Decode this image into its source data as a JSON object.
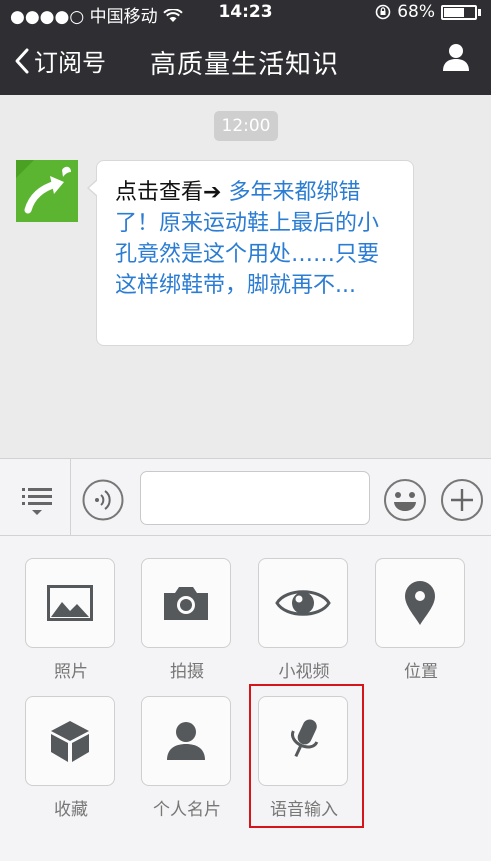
{
  "status_bar": {
    "signal": "●●●●○ 中国移动",
    "time": "14:23",
    "battery_pct": "68%",
    "battery_level": 0.68
  },
  "nav": {
    "back_label": "订阅号",
    "title": "高质量生活知识"
  },
  "chat": {
    "timestamp": "12:00",
    "message": {
      "lead": "点击查看",
      "arrow": "➔",
      "link_text": " 多年来都绑错了！原来运动鞋上最后的小孔竟然是这个用处……只要这样绑鞋带，脚就再不..."
    }
  },
  "input_bar": {
    "text_value": "",
    "placeholder": ""
  },
  "panel_items": [
    {
      "label": "照片",
      "icon": "photo-icon"
    },
    {
      "label": "拍摄",
      "icon": "camera-icon"
    },
    {
      "label": "小视频",
      "icon": "eye-icon"
    },
    {
      "label": "位置",
      "icon": "location-pin-icon"
    },
    {
      "label": "收藏",
      "icon": "cube-icon"
    },
    {
      "label": "个人名片",
      "icon": "person-icon"
    },
    {
      "label": "语音输入",
      "icon": "microphone-icon"
    }
  ],
  "colors": {
    "nav_bg": "#2e2e33",
    "link": "#2b7cd3",
    "highlight": "#d4161c",
    "icon": "#55595c"
  }
}
